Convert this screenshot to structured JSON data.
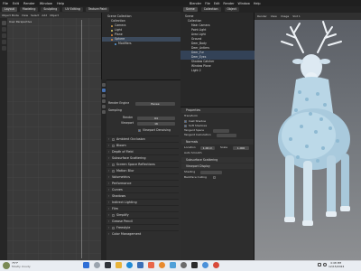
{
  "left_window": {
    "menu": [
      "File",
      "Edit",
      "Render",
      "Window",
      "Help"
    ],
    "tabs": [
      "Layout",
      "Modeling",
      "Sculpting",
      "UV Editing",
      "Texture Paint"
    ],
    "viewport_header": [
      "Object Mode",
      "View",
      "Select",
      "Add",
      "Object"
    ],
    "viewport_label": "User Perspective",
    "outliner": {
      "rows": [
        {
          "label": "Scene Collection",
          "selected": false
        },
        {
          "label": "Collection",
          "selected": false
        },
        {
          "label": "Camera",
          "selected": false
        },
        {
          "label": "Light",
          "selected": false
        },
        {
          "label": "Plane",
          "selected": false
        },
        {
          "label": "Sphere",
          "selected": true
        },
        {
          "label": "Modifiers",
          "selected": false
        }
      ]
    },
    "properties": {
      "engine_label": "Render Engine",
      "engine_value": "Eevee",
      "sampling_label": "Sampling",
      "render_label": "Render",
      "render_value": "64",
      "viewport_label": "Viewport",
      "viewport_value": "16",
      "denoise_label": "Viewport Denoising",
      "sections": [
        "Ambient Occlusion",
        "Bloom",
        "Depth of Field",
        "Subsurface Scattering",
        "Screen Space Reflections",
        "Motion Blur",
        "Volumetrics",
        "Performance",
        "Curves",
        "Shadows",
        "Indirect Lighting",
        "Film",
        "Simplify",
        "Grease Pencil",
        "Freestyle",
        "Color Management"
      ],
      "checked_sections": [
        "Ambient Occlusion",
        "Bloom"
      ]
    }
  },
  "right_window": {
    "menu": [
      "Blender",
      "File",
      "Edit",
      "Render",
      "Window",
      "Help"
    ],
    "tabs": [
      "Scene",
      "Collection",
      "Object"
    ],
    "outliner": {
      "rows": [
        {
          "label": "Scene",
          "selected": false
        },
        {
          "label": "Collection",
          "selected": false
        },
        {
          "label": "Main Camera",
          "selected": false
        },
        {
          "label": "Point Light",
          "selected": false
        },
        {
          "label": "Area Light",
          "selected": false
        },
        {
          "label": "Ground",
          "selected": false
        },
        {
          "label": "Deer_Body",
          "selected": false
        },
        {
          "label": "Deer_Antlers",
          "selected": false
        },
        {
          "label": "Deer_Fur",
          "selected": true
        },
        {
          "label": "Deer_Eyes",
          "selected": true
        },
        {
          "label": "Shadow Catcher",
          "selected": false
        },
        {
          "label": "Window Plane",
          "selected": false
        },
        {
          "label": "Light 2",
          "selected": false
        }
      ]
    },
    "properties": {
      "header": "Properties",
      "rows": [
        "Transform",
        "Cast Shadow",
        "Soft Shadows",
        "Tangent Space",
        "Tangent Calculation",
        "Normals",
        "Auto Smooth",
        "Subsurface Scattering",
        "Viewport Display",
        "Shading",
        "Backface Culling"
      ],
      "location_label": "Location",
      "location_value": "1.00 m",
      "scale_label": "Scale",
      "scale_value": "1.000"
    },
    "render_header": [
      "Render",
      "View",
      "Image",
      "Slot 1"
    ]
  },
  "taskbar": {
    "time": "4:48 PM",
    "date": "12/15/2024",
    "temp": "75°F",
    "weather": "Mostly cloudy",
    "icons": [
      "start-icon",
      "search-icon",
      "task-view-icon",
      "file-explorer-icon",
      "edge-icon",
      "store-icon",
      "mail-icon",
      "blender-icon",
      "photos-icon",
      "settings-icon",
      "terminal-icon",
      "browser-icon",
      "chrome-icon"
    ]
  }
}
